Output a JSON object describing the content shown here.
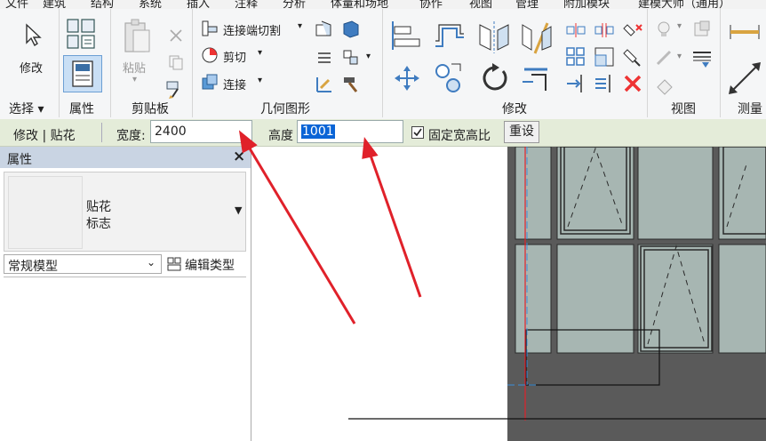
{
  "menu": [
    "文件",
    "建筑",
    "结构",
    "系统",
    "插入",
    "注释",
    "分析",
    "体量和场地",
    "协作",
    "视图",
    "管理",
    "附加模块",
    "建模大师（通用）"
  ],
  "ribbon": {
    "select_panel": {
      "modify_label": "修改",
      "panel_label": "选择 ▾"
    },
    "properties_panel": {
      "panel_label": "属性"
    },
    "clipboard_panel": {
      "paste_label": "粘贴",
      "panel_label": "剪贴板"
    },
    "geometry_panel": {
      "cut_join_label": "连接端切割",
      "cut_label": "剪切",
      "join_label": "连接",
      "panel_label": "几何图形"
    },
    "modify_panel": {
      "panel_label": "修改"
    },
    "view_panel": {
      "panel_label": "视图"
    },
    "measure_panel": {
      "panel_label": "测量"
    }
  },
  "options_bar": {
    "context_label": "修改 | 贴花",
    "width_label": "宽度:",
    "width_value": "2400",
    "height_label": "高度",
    "height_value": "1001",
    "lock_ratio_label": "固定宽高比",
    "lock_ratio_checked": true,
    "reset_label": "重设"
  },
  "properties": {
    "title": "属性",
    "type_name_line1": "贴花",
    "type_name_line2": "标志",
    "category": "常规模型",
    "edit_type_label": "编辑类型"
  },
  "colors": {
    "arrow_red": "#e0212a",
    "facade_gray": "#5a5a5a",
    "glass": "#a7b6b2",
    "highlight_blue": "#0a64d6",
    "options_bar_bg": "#e4ecd9"
  }
}
